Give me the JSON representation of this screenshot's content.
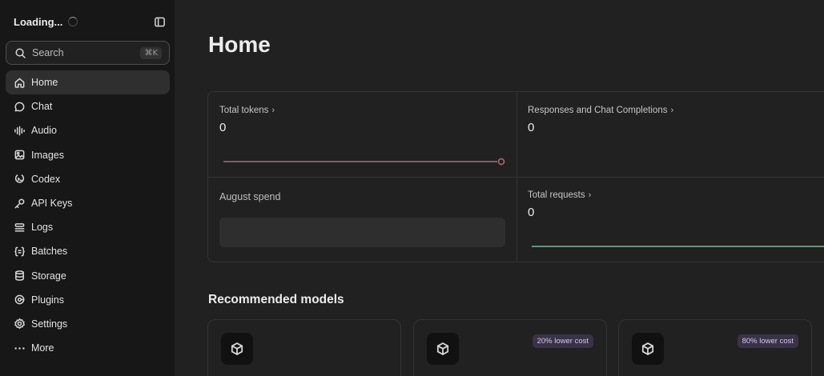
{
  "sidebar": {
    "title": "Loading...",
    "search": {
      "label": "Search",
      "shortcut": "⌘K"
    },
    "items": [
      {
        "label": "Home",
        "icon": "home-icon",
        "active": true
      },
      {
        "label": "Chat",
        "icon": "chat-bubble-icon"
      },
      {
        "label": "Audio",
        "icon": "waveform-icon"
      },
      {
        "label": "Images",
        "icon": "image-icon"
      },
      {
        "label": "Codex",
        "icon": "codex-icon"
      },
      {
        "label": "API Keys",
        "icon": "key-icon"
      },
      {
        "label": "Logs",
        "icon": "stack-icon"
      },
      {
        "label": "Batches",
        "icon": "braces-icon"
      },
      {
        "label": "Storage",
        "icon": "database-icon"
      },
      {
        "label": "Plugins",
        "icon": "plugin-icon"
      },
      {
        "label": "Settings",
        "icon": "gear-icon"
      },
      {
        "label": "More",
        "icon": "more-dots-icon"
      }
    ]
  },
  "main": {
    "title": "Home",
    "stats": {
      "total_tokens": {
        "label": "Total tokens",
        "value": "0"
      },
      "responses": {
        "label": "Responses and Chat Completions",
        "value": "0"
      },
      "spend": {
        "label": "August spend"
      },
      "total_requests": {
        "label": "Total requests",
        "value": "0"
      }
    },
    "recommended": {
      "title": "Recommended models",
      "cards": [
        {
          "icon": "cube-icon",
          "badge": ""
        },
        {
          "icon": "cube-icon",
          "badge": "20% lower cost"
        },
        {
          "icon": "cube-icon",
          "badge": "80% lower cost"
        }
      ]
    }
  },
  "colors": {
    "tokens_line": "#a86e7c",
    "requests_line": "#7fb59a",
    "badge_bg": "#3a3246"
  }
}
